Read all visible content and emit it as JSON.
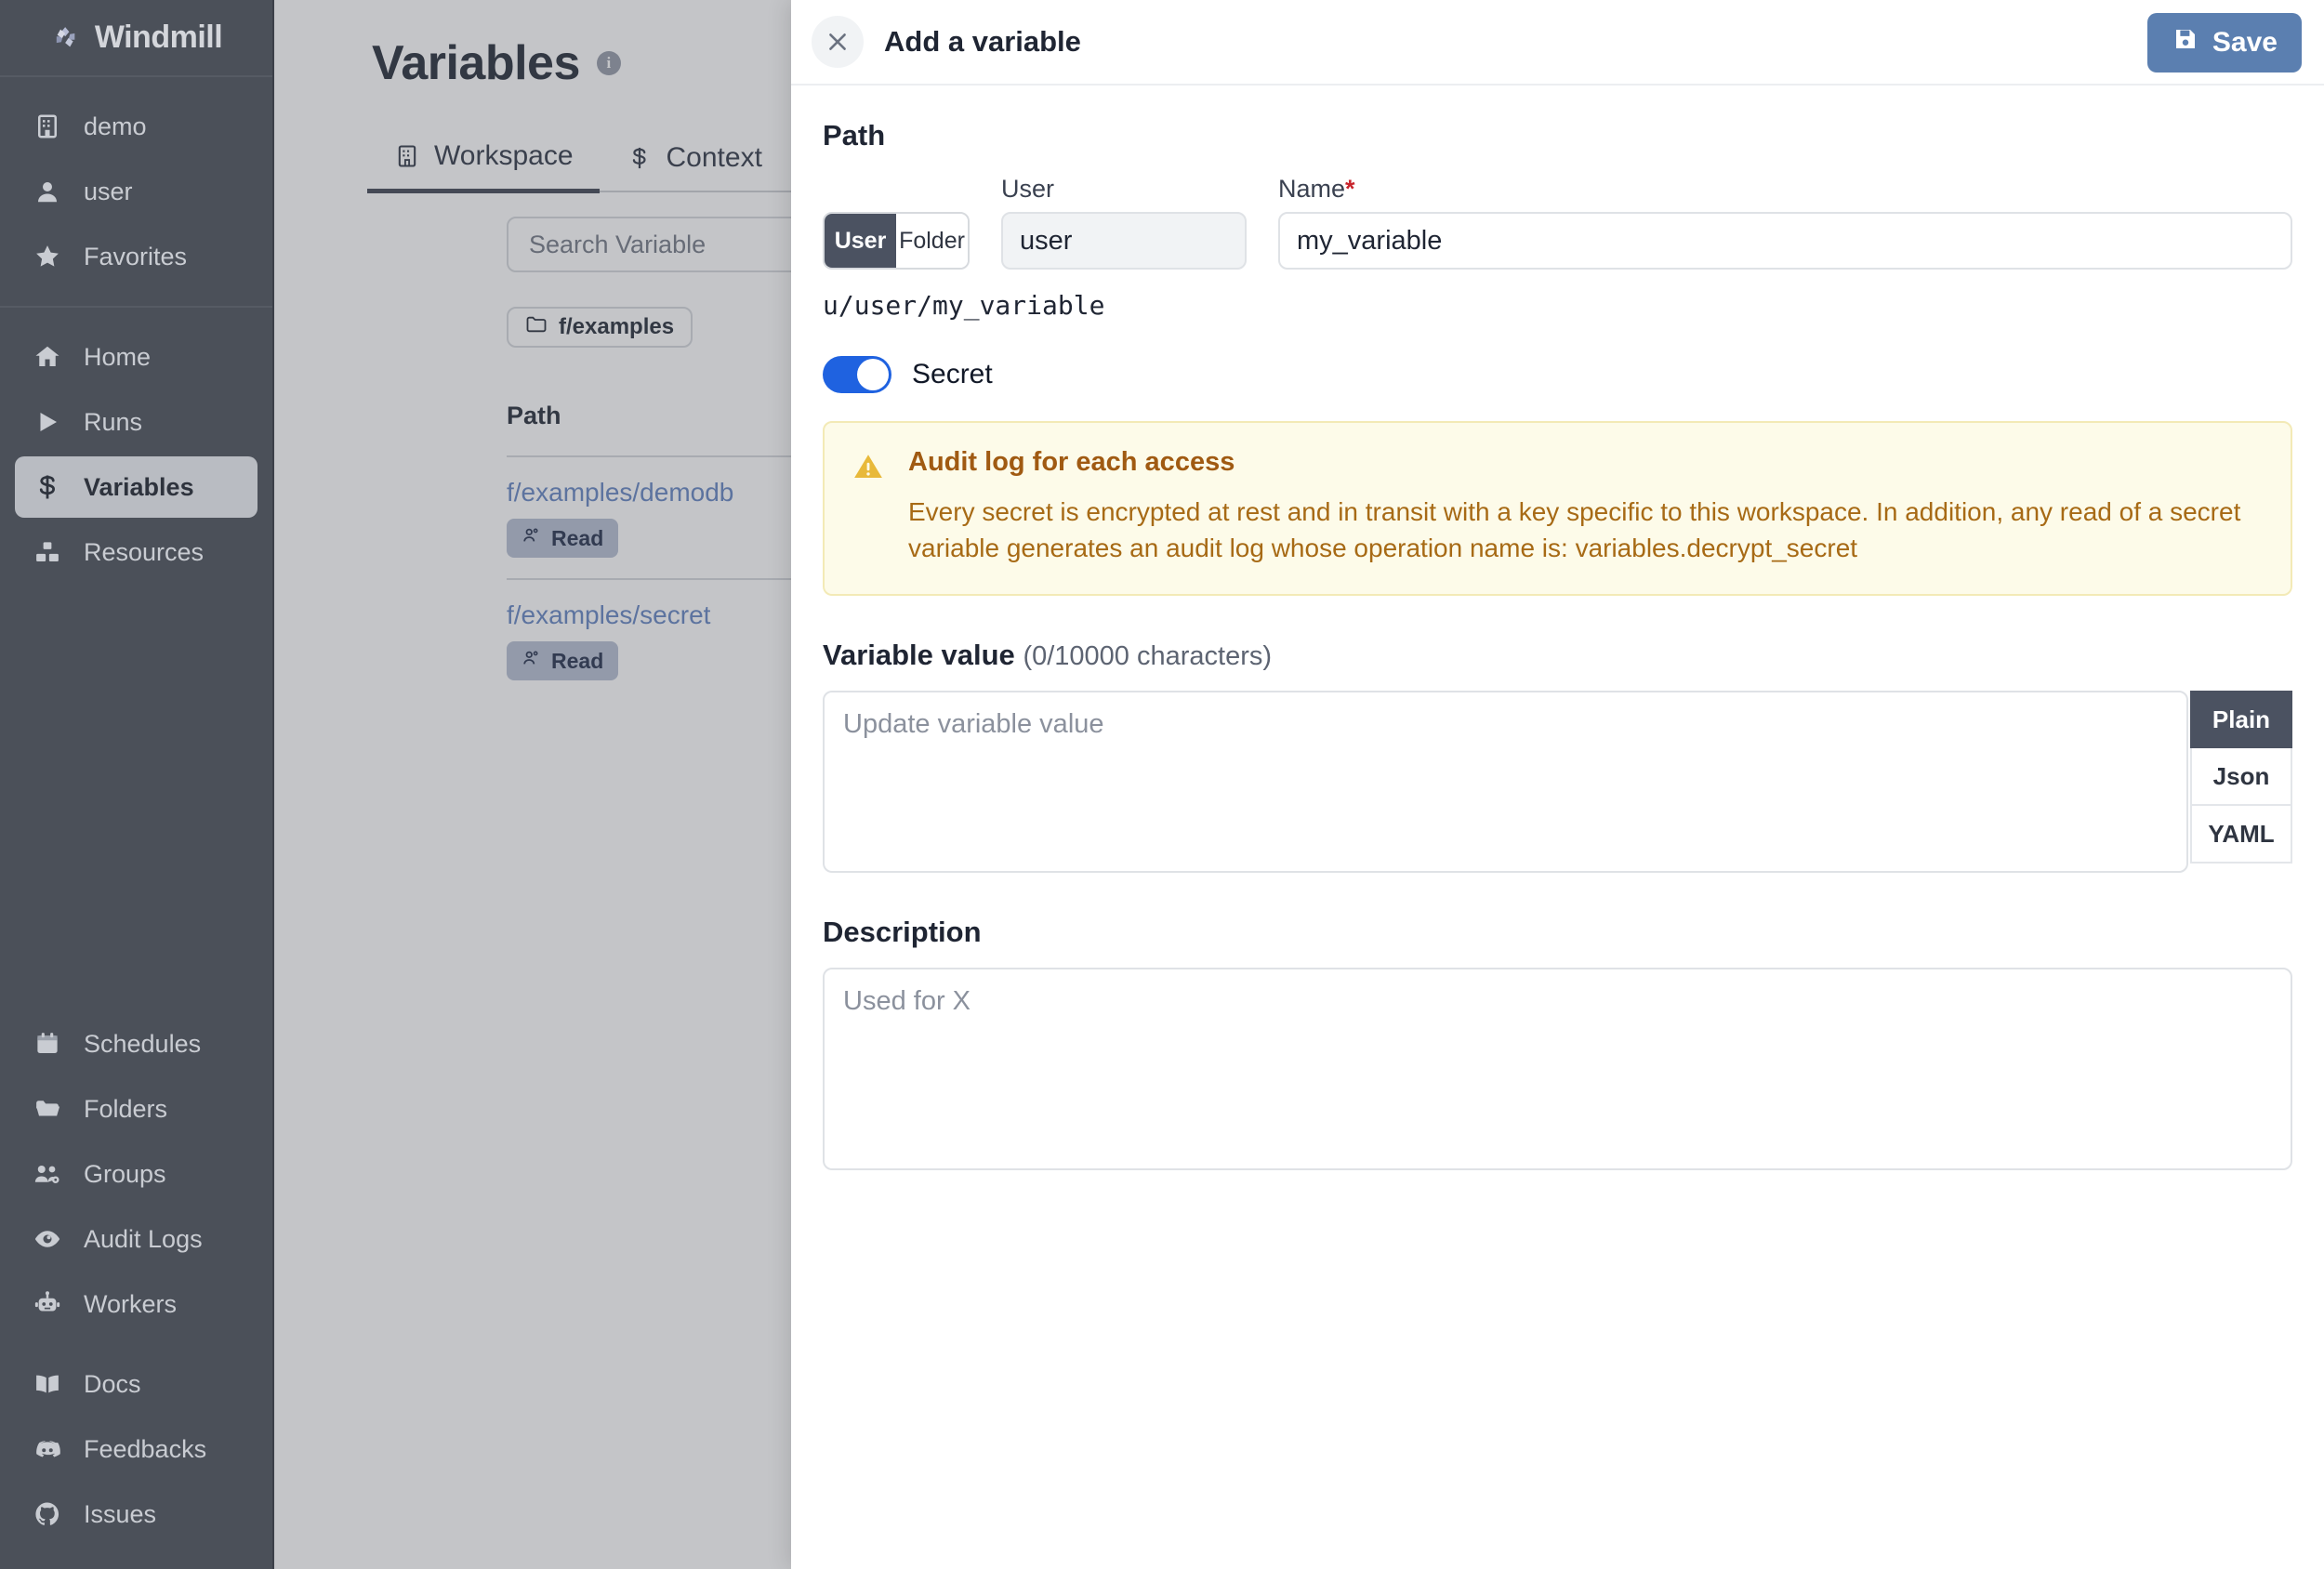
{
  "app": {
    "name": "Windmill"
  },
  "sidebar": {
    "workspace_items": [
      {
        "label": "demo",
        "icon": "building-icon"
      },
      {
        "label": "user",
        "icon": "user-icon"
      },
      {
        "label": "Favorites",
        "icon": "star-icon"
      }
    ],
    "main_items": [
      {
        "label": "Home",
        "icon": "home-icon",
        "active": false
      },
      {
        "label": "Runs",
        "icon": "play-icon",
        "active": false
      },
      {
        "label": "Variables",
        "icon": "dollar-icon",
        "active": true
      },
      {
        "label": "Resources",
        "icon": "blocks-icon",
        "active": false
      }
    ],
    "admin_items": [
      {
        "label": "Schedules",
        "icon": "calendar-icon"
      },
      {
        "label": "Folders",
        "icon": "folder-icon"
      },
      {
        "label": "Groups",
        "icon": "users-gear-icon"
      },
      {
        "label": "Audit Logs",
        "icon": "eye-icon"
      },
      {
        "label": "Workers",
        "icon": "robot-icon"
      }
    ],
    "footer_items": [
      {
        "label": "Docs",
        "icon": "book-icon"
      },
      {
        "label": "Feedbacks",
        "icon": "discord-icon"
      },
      {
        "label": "Issues",
        "icon": "github-icon"
      }
    ]
  },
  "page": {
    "title": "Variables",
    "info_char": "i",
    "tabs": [
      {
        "label": "Workspace",
        "icon": "building-icon",
        "active": true
      },
      {
        "label": "Context",
        "icon": "dollar-icon",
        "active": false
      }
    ],
    "search_placeholder": "Search Variable",
    "folder_chip": "f/examples",
    "list_header": "Path",
    "rows": [
      {
        "path": "f/examples/demodb",
        "permission": "Read"
      },
      {
        "path": "f/examples/secret",
        "permission": "Read"
      }
    ]
  },
  "drawer": {
    "title": "Add a variable",
    "close_label": "×",
    "save_label": "Save",
    "path": {
      "section_label": "Path",
      "kind_options": [
        {
          "label": "User",
          "selected": true
        },
        {
          "label": "Folder",
          "selected": false
        }
      ],
      "user_label": "User",
      "user_value": "user",
      "name_label": "Name",
      "name_required_mark": "*",
      "name_value": "my_variable",
      "preview": "u/user/my_variable"
    },
    "secret": {
      "label": "Secret",
      "enabled": true,
      "alert_title": "Audit log for each access",
      "alert_body": "Every secret is encrypted at rest and in transit with a key specific to this workspace. In addition, any read of a secret variable generates an audit log whose operation name is: variables.decrypt_secret"
    },
    "value": {
      "label": "Variable value",
      "counter": "(0/10000 characters)",
      "placeholder": "Update variable value",
      "current": "",
      "format_tabs": [
        {
          "label": "Plain",
          "selected": true
        },
        {
          "label": "Json",
          "selected": false
        },
        {
          "label": "YAML",
          "selected": false
        }
      ]
    },
    "description": {
      "label": "Description",
      "placeholder": "Used for X",
      "current": ""
    }
  },
  "colors": {
    "sidebar_bg": "#4b5059",
    "accent_blue": "#5b7fb0",
    "toggle_on": "#1f62e0",
    "alert_bg": "#fdfbe9",
    "alert_text": "#a76a15",
    "link_blue": "#6b8ac4",
    "required_red": "#c8242c"
  }
}
